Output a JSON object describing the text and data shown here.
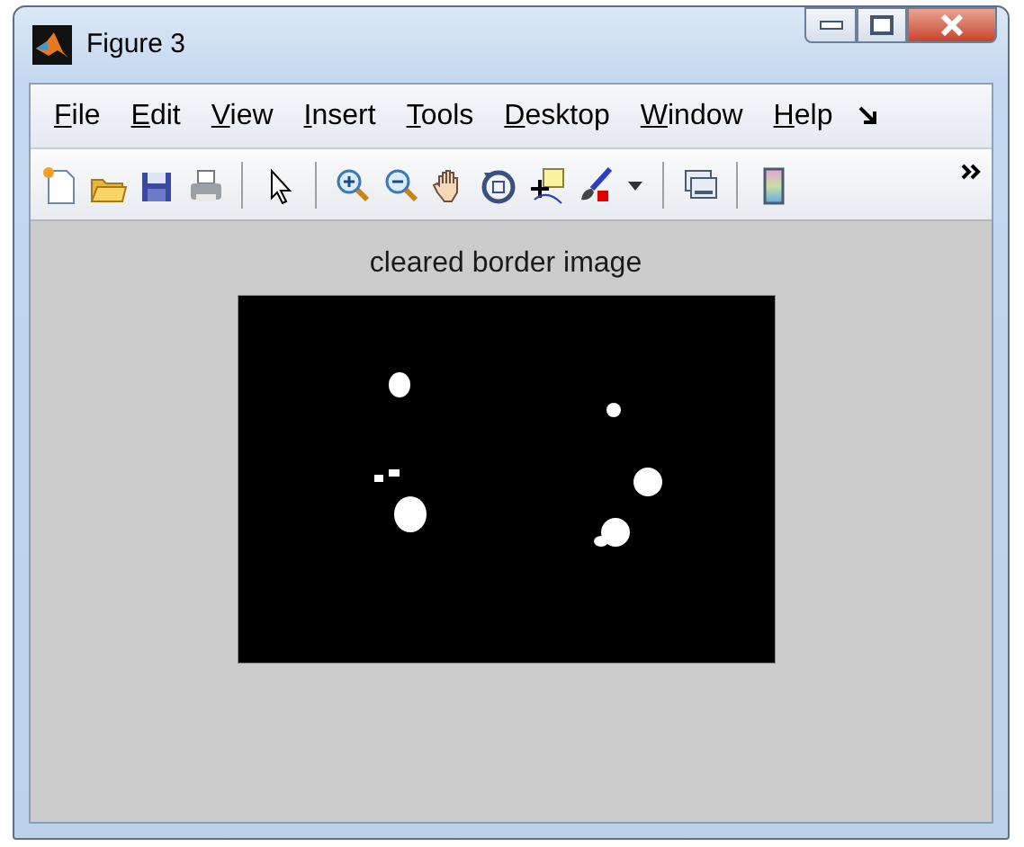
{
  "window": {
    "title": "Figure 3"
  },
  "menu": [
    {
      "label": "File"
    },
    {
      "label": "Edit"
    },
    {
      "label": "View"
    },
    {
      "label": "Insert"
    },
    {
      "label": "Tools"
    },
    {
      "label": "Desktop"
    },
    {
      "label": "Window"
    },
    {
      "label": "Help"
    }
  ],
  "axes": {
    "title": "cleared border image"
  }
}
